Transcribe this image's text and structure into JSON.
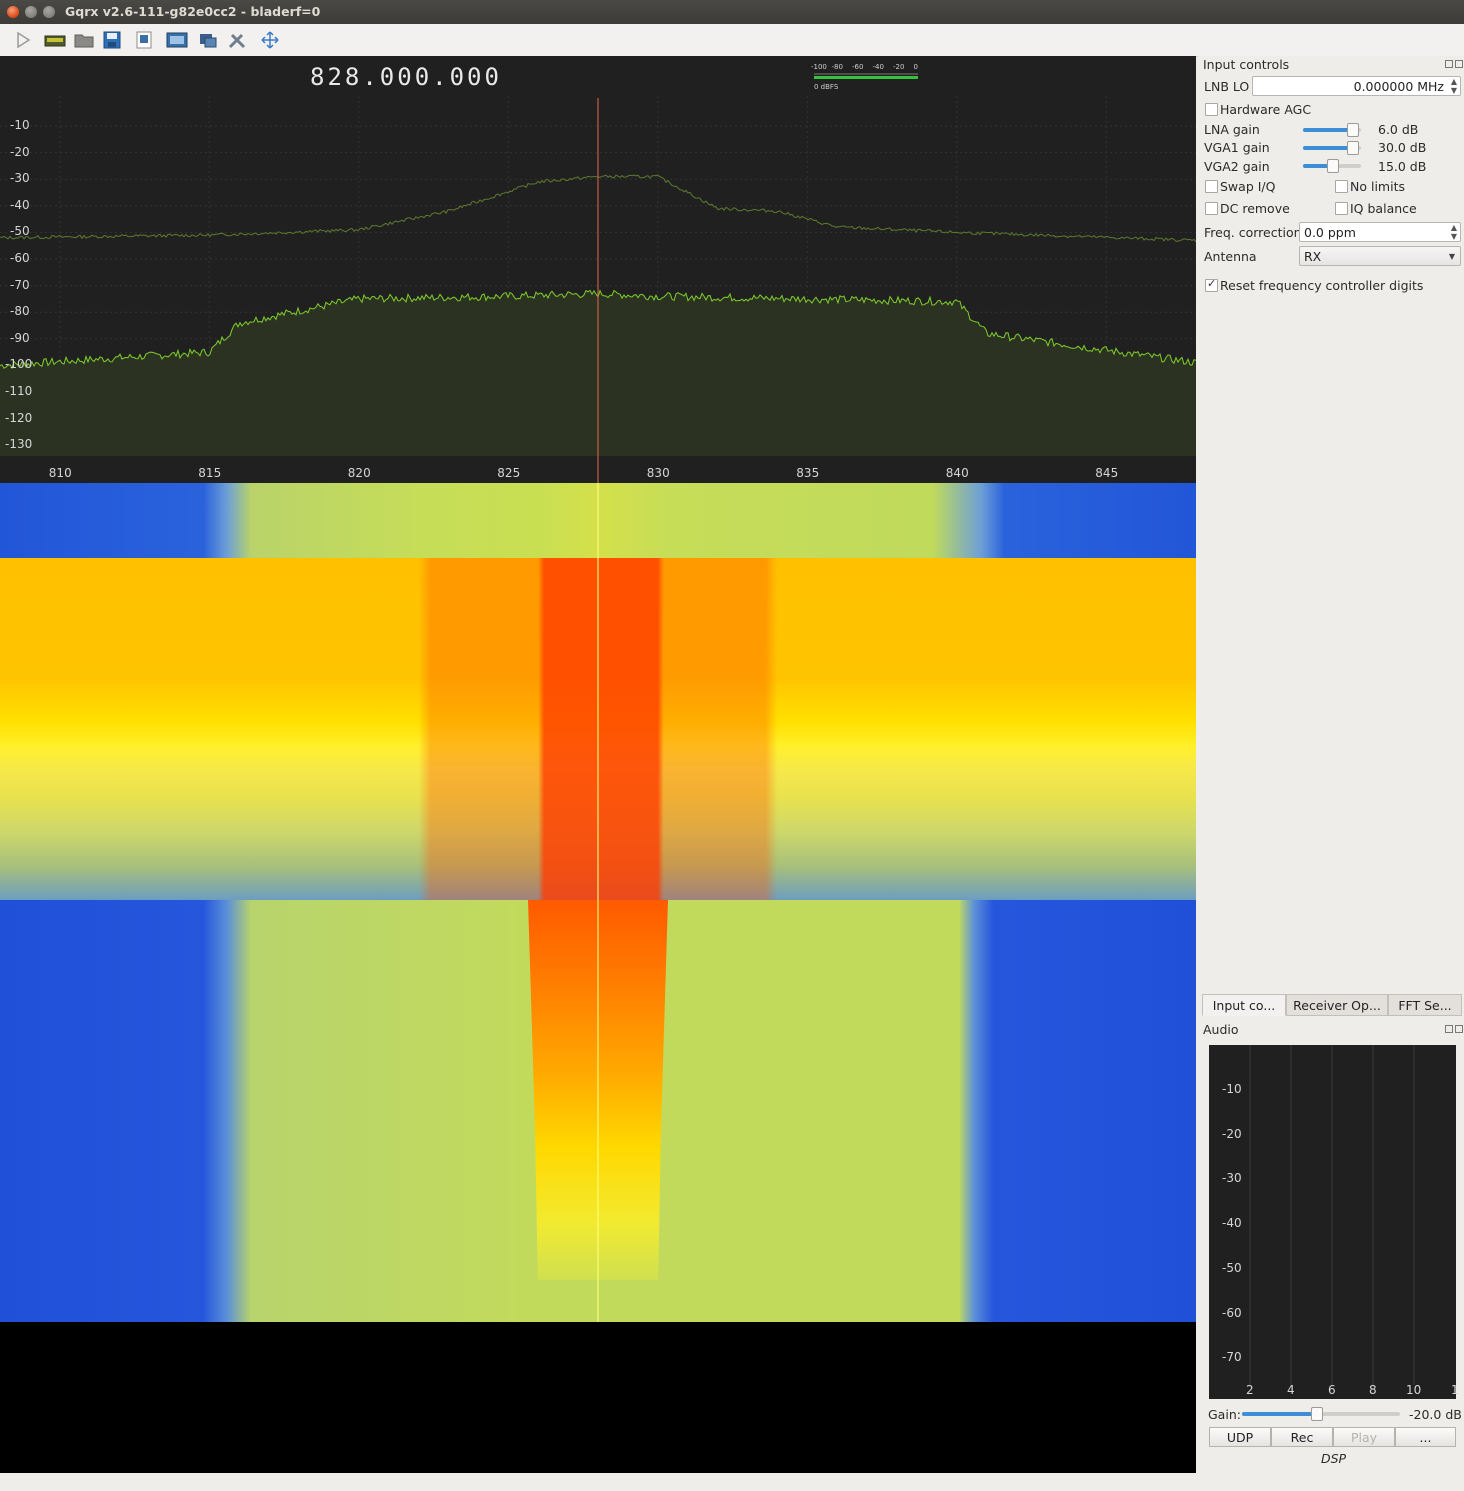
{
  "window": {
    "title": "Gqrx v2.6-111-g82e0cc2 - bladerf=0"
  },
  "toolbar": {
    "icons": [
      "play-icon",
      "hardware-config-icon",
      "open-folder-icon",
      "save-icon",
      "save-as-icon",
      "device-icon",
      "remote-icon",
      "settings-icon",
      "auto-fit-icon"
    ]
  },
  "plot": {
    "frequency": "828.000.000",
    "y_ticks": [
      "-10",
      "-20",
      "-30",
      "-40",
      "-50",
      "-60",
      "-70",
      "-80",
      "-90",
      "-100",
      "-110",
      "-120",
      "-130"
    ],
    "x_ticks": [
      "810",
      "815",
      "820",
      "825",
      "830",
      "835",
      "840",
      "845"
    ],
    "meter_ticks": [
      "-100",
      "-80",
      "-60",
      "-40",
      "-20",
      "0"
    ],
    "meter_unit": "0 dBFS"
  },
  "chart_data": {
    "type": "line",
    "title": "",
    "xlabel": "",
    "ylabel": "",
    "xlim": [
      808,
      848
    ],
    "ylim": [
      -135,
      0
    ],
    "series": [
      {
        "values_x": [
          808,
          815,
          816,
          820,
          825,
          828,
          830,
          835,
          840,
          841,
          848
        ],
        "values": [
          -100,
          -95,
          -84,
          -75,
          -74,
          -73,
          -74,
          -75,
          -76,
          -88,
          -99
        ]
      },
      {
        "values_x": [
          808,
          815,
          820,
          823,
          826,
          828,
          830,
          832,
          834,
          836,
          840,
          848
        ],
        "values": [
          -52,
          -51,
          -49,
          -42,
          -31,
          -29,
          -29,
          -41,
          -42,
          -48,
          -50,
          -53
        ]
      }
    ],
    "marker_x": 828
  },
  "input_controls": {
    "title": "Input controls",
    "lnb_label": "LNB LO",
    "lnb_value": "0.000000 MHz",
    "hw_agc": "Hardware AGC",
    "lna_label": "LNA gain",
    "lna_value": "6.0 dB",
    "lna_level": 0.85,
    "vga1_label": "VGA1 gain",
    "vga1_value": "30.0 dB",
    "vga1_level": 0.85,
    "vga2_label": "VGA2 gain",
    "vga2_value": "15.0 dB",
    "vga2_level": 0.5,
    "swap_iq": "Swap I/Q",
    "no_limits": "No limits",
    "dc_remove": "DC remove",
    "iq_balance": "IQ balance",
    "freq_corr_label": "Freq. correction",
    "freq_corr_value": "0.0 ppm",
    "antenna_label": "Antenna",
    "antenna_value": "RX",
    "reset_digits": "Reset frequency controller digits"
  },
  "tabs": [
    "Input co...",
    "Receiver Op...",
    "FFT Se..."
  ],
  "audio": {
    "title": "Audio",
    "y_ticks": [
      "-10",
      "-20",
      "-30",
      "-40",
      "-50",
      "-60",
      "-70"
    ],
    "x_ticks": [
      "2",
      "4",
      "6",
      "8",
      "10",
      "1"
    ],
    "gain_label": "Gain:",
    "gain_value": "-20.0 dB",
    "gain_level": 0.47,
    "buttons": [
      "UDP",
      "Rec",
      "Play",
      "..."
    ],
    "dsp": "DSP"
  }
}
